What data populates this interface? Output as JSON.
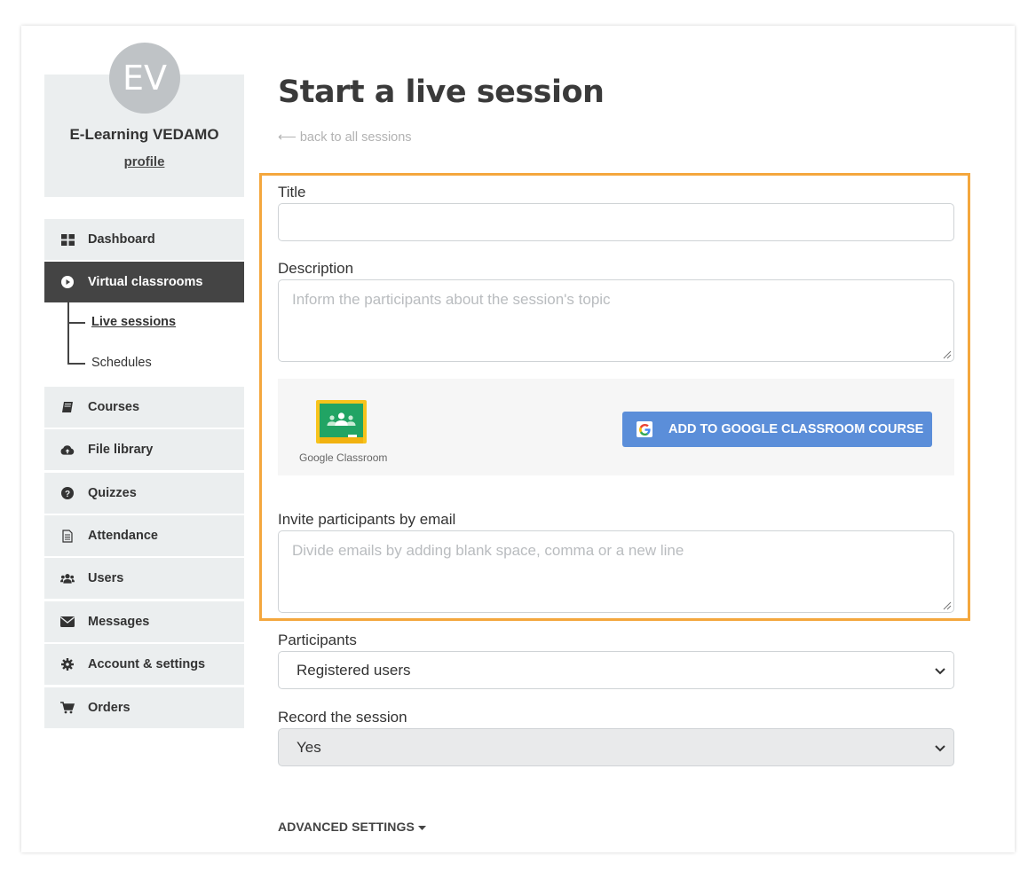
{
  "profile": {
    "initials": "EV",
    "name": "E-Learning VEDAMO",
    "link": "profile"
  },
  "sidebar": {
    "items": [
      {
        "label": "Dashboard",
        "icon": "dashboard-icon"
      },
      {
        "label": "Virtual classrooms",
        "icon": "play-circle-icon",
        "active": true
      },
      {
        "label": "Courses",
        "icon": "book-icon"
      },
      {
        "label": "File library",
        "icon": "cloud-upload-icon"
      },
      {
        "label": "Quizzes",
        "icon": "question-circle-icon"
      },
      {
        "label": "Attendance",
        "icon": "document-icon"
      },
      {
        "label": "Users",
        "icon": "users-icon"
      },
      {
        "label": "Messages",
        "icon": "envelope-icon"
      },
      {
        "label": "Account & settings",
        "icon": "gear-icon"
      },
      {
        "label": "Orders",
        "icon": "cart-icon"
      }
    ],
    "subitems": [
      {
        "label": "Live sessions",
        "active": true
      },
      {
        "label": "Schedules"
      }
    ]
  },
  "main": {
    "title": "Start a live session",
    "back_link": "⟵ back to all sessions",
    "title_field": {
      "label": "Title",
      "value": ""
    },
    "description_field": {
      "label": "Description",
      "placeholder": "Inform the participants about the session's topic"
    },
    "google_classroom": {
      "logo_text": "Google Classroom",
      "button_label": "ADD TO GOOGLE CLASSROOM COURSE"
    },
    "invite_field": {
      "label": "Invite participants by email",
      "placeholder": "Divide emails by adding blank space, comma or a new line"
    },
    "participants_field": {
      "label": "Participants",
      "value": "Registered users"
    },
    "record_field": {
      "label": "Record the session",
      "value": "Yes"
    },
    "advanced_settings": "ADVANCED SETTINGS"
  },
  "colors": {
    "highlight": "#f4a73d",
    "google_button": "#5b8ed9",
    "active_nav": "#444444",
    "sidebar_bg": "#ebeeef"
  }
}
